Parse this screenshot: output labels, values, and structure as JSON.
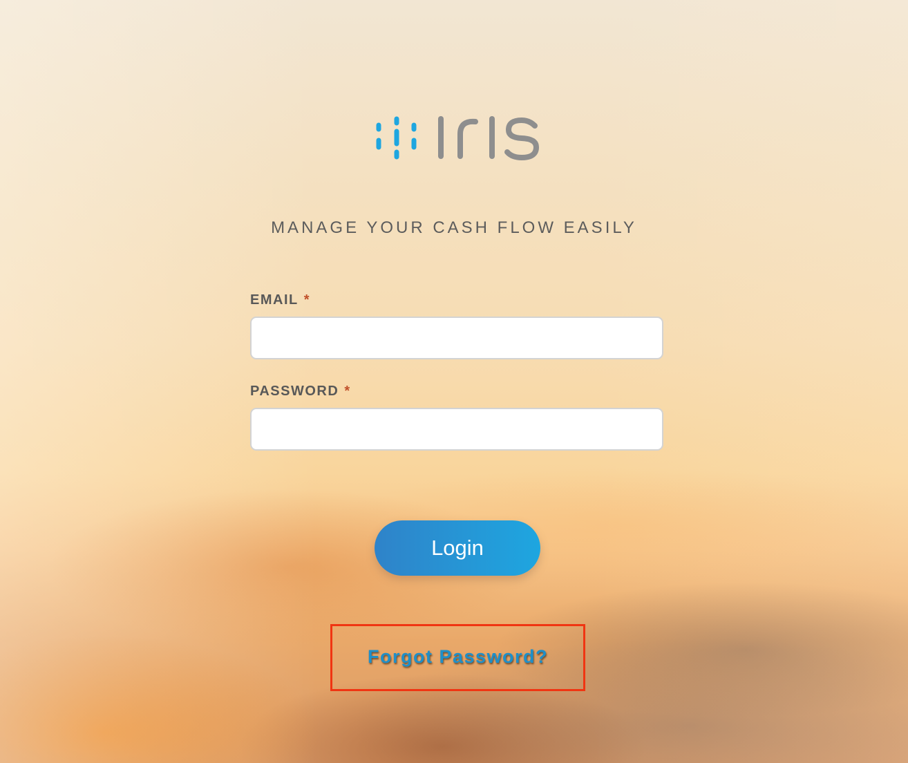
{
  "brand": {
    "name": "iris",
    "accent_color": "#1ea6e0",
    "wordmark_color": "#8e8e8e"
  },
  "tagline": "MANAGE YOUR CASH FLOW EASILY",
  "form": {
    "email": {
      "label": "EMAIL",
      "required_mark": "*",
      "value": "",
      "placeholder": ""
    },
    "password": {
      "label": "PASSWORD",
      "required_mark": "*",
      "value": "",
      "placeholder": ""
    },
    "login_label": "Login",
    "forgot_password_label": "Forgot Password?"
  },
  "highlight": {
    "color": "#f03512",
    "target": "forgot-password-link"
  }
}
